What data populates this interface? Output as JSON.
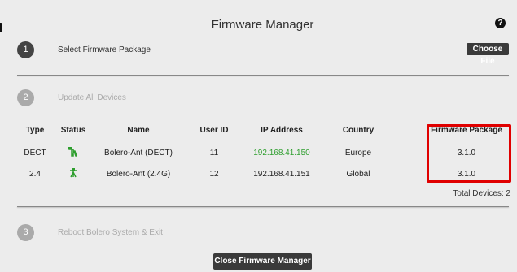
{
  "window": {
    "title": "Firmware Manager",
    "help_icon": "?"
  },
  "steps": [
    {
      "number": "1",
      "label": "Select Firmware Package",
      "state": "active"
    },
    {
      "number": "2",
      "label": "Update All Devices",
      "state": "muted"
    },
    {
      "number": "3",
      "label": "Reboot Bolero System & Exit",
      "state": "muted"
    }
  ],
  "choose_file_label": "Choose File",
  "table": {
    "headers": [
      "Type",
      "Status",
      "Name",
      "User ID",
      "IP Address",
      "Country",
      "Firmware Package"
    ],
    "rows": [
      {
        "type": "DECT",
        "status_icon": "antenna-icon",
        "name": "Bolero-Ant (DECT)",
        "user_id": "11",
        "ip": "192.168.41.150",
        "country": "Europe",
        "firmware": "3.1.0"
      },
      {
        "type": "2.4",
        "status_icon": "antenna-icon",
        "name": "Bolero-Ant (2.4G)",
        "user_id": "12",
        "ip": "192.168.41.151",
        "country": "Global",
        "firmware": "3.1.0"
      }
    ],
    "total_devices": "Total Devices: 2"
  },
  "close_button_label": "Close Firmware Manager",
  "colors": {
    "accent_green": "#2e9e2e",
    "highlight_red": "#e00000",
    "dark_button": "#3a3a3a"
  }
}
